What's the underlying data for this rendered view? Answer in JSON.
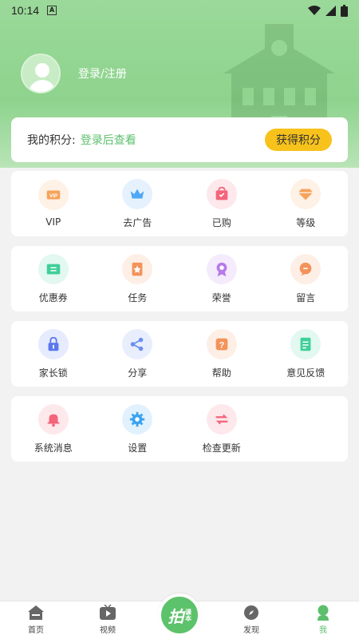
{
  "status_bar": {
    "time": "10:14",
    "notif": "A"
  },
  "profile": {
    "login_label": "登录/注册"
  },
  "points": {
    "label": "我的积分:",
    "value": "登录后查看",
    "button": "获得积分"
  },
  "grid_rows": [
    [
      {
        "label": "VIP",
        "icon": "vip-icon",
        "color": "#f6a35b"
      },
      {
        "label": "去广告",
        "icon": "crown-icon",
        "color": "#4fa8f4"
      },
      {
        "label": "已购",
        "icon": "bag-icon",
        "color": "#f4647a"
      },
      {
        "label": "等级",
        "icon": "diamond-icon",
        "color": "#f6a35b"
      }
    ],
    [
      {
        "label": "优惠券",
        "icon": "coupon-icon",
        "color": "#3fcf9a"
      },
      {
        "label": "任务",
        "icon": "task-icon",
        "color": "#f3935a"
      },
      {
        "label": "荣誉",
        "icon": "medal-icon",
        "color": "#b77ae8"
      },
      {
        "label": "留言",
        "icon": "message-icon",
        "color": "#f3935a"
      }
    ],
    [
      {
        "label": "家长锁",
        "icon": "lock-icon",
        "color": "#5b78f0"
      },
      {
        "label": "分享",
        "icon": "share-icon",
        "color": "#6b8ef0"
      },
      {
        "label": "帮助",
        "icon": "help-icon",
        "color": "#f3935a"
      },
      {
        "label": "意见反馈",
        "icon": "feedback-icon",
        "color": "#3fcf9a"
      }
    ],
    [
      {
        "label": "系统消息",
        "icon": "bell-icon",
        "color": "#f4647a"
      },
      {
        "label": "设置",
        "icon": "settings-icon",
        "color": "#3aa3f0"
      },
      {
        "label": "检查更新",
        "icon": "update-icon",
        "color": "#f4647a"
      }
    ]
  ],
  "tabs": [
    {
      "label": "首页",
      "icon": "home-icon"
    },
    {
      "label": "视频",
      "icon": "video-icon"
    },
    {
      "label": "",
      "icon": "center"
    },
    {
      "label": "发现",
      "icon": "compass-icon"
    },
    {
      "label": "我",
      "icon": "me-icon"
    }
  ],
  "center_logo": {
    "big": "拍",
    "small": "课本"
  },
  "colors": {
    "accent": "#5bbf6b",
    "header": "#8ed38d",
    "gold": "#f7c21b"
  }
}
